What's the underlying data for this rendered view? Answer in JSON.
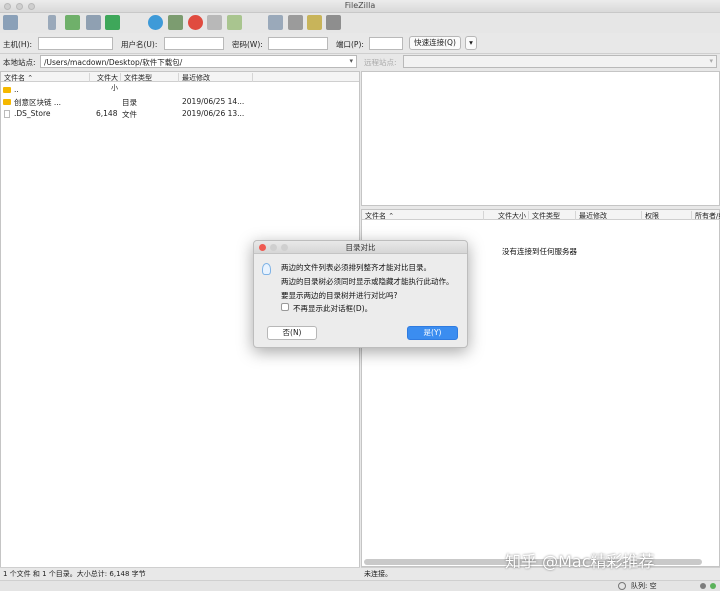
{
  "app": {
    "title": "FileZilla"
  },
  "quickconnect": {
    "host_label": "主机(H):",
    "user_label": "用户名(U):",
    "pass_label": "密码(W):",
    "port_label": "端口(P):",
    "connect_button": "快速连接(Q)",
    "dropdown_arrow": "▾"
  },
  "local": {
    "site_label": "本地站点:",
    "path": "/Users/macdown/Desktop/软件下载包/",
    "columns": [
      "文件名",
      "文件大小",
      "文件类型",
      "最近修改"
    ],
    "rows": [
      {
        "name": "..",
        "size": "",
        "type": "",
        "modified": "",
        "icon": "folder-icon"
      },
      {
        "name": "创意区块链 ...",
        "size": "",
        "type": "目录",
        "modified": "2019/06/25 14...",
        "icon": "folder-icon"
      },
      {
        "name": ".DS_Store",
        "size": "6,148",
        "type": "文件",
        "modified": "2019/06/26 13...",
        "icon": "file-icon"
      }
    ],
    "status": "1 个文件 和 1 个目录。大小总计: 6,148 字节"
  },
  "remote": {
    "site_label": "远程站点:",
    "path": "",
    "columns": [
      "文件名",
      "文件大小",
      "文件类型",
      "最近修改",
      "权限",
      "所有者/组"
    ],
    "empty_message": "没有连接到任何服务器",
    "status": "未连接。"
  },
  "dialog": {
    "title": "目录对比",
    "lines": [
      "两边的文件列表必须排列整齐才能对比目录。",
      "两边的目录树必须同时显示或隐藏才能执行此动作。",
      "要显示两边的目录树并进行对比吗?"
    ],
    "checkbox_label": "不再显示此对话框(D)。",
    "checkbox_checked": false,
    "no_button": "否(N)",
    "yes_button": "是(Y)",
    "yes_color": "#3b8df0"
  },
  "footer": {
    "queue": "队列: 空"
  },
  "watermark": "知乎 @Mac精彩推荐"
}
